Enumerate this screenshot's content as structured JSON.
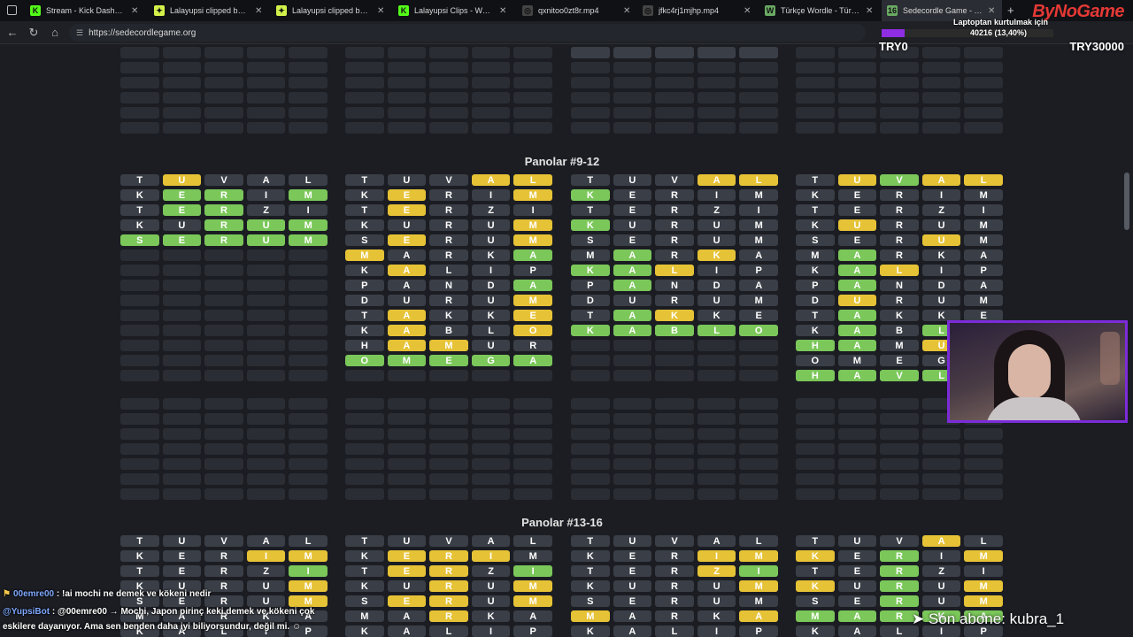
{
  "tabs": [
    {
      "label": "Stream - Kick Dashboard",
      "icon": "kick-icon",
      "icon_text": "K",
      "icon_color": "#53fc18"
    },
    {
      "label": "Lalayupsi clipped by cinoc",
      "icon": "clip-icon",
      "icon_text": "✦",
      "icon_color": "#d2f14a"
    },
    {
      "label": "Lalayupsi clipped by FFYou",
      "icon": "clip-icon",
      "icon_text": "✦",
      "icon_color": "#d2f14a"
    },
    {
      "label": "Lalayupsi Clips - Watch Liv",
      "icon": "kick-icon",
      "icon_text": "K",
      "icon_color": "#53fc18"
    },
    {
      "label": "qxnitoo0zt8r.mp4",
      "icon": "globe-icon",
      "icon_text": "◎",
      "icon_color": "#444"
    },
    {
      "label": "jfkc4rj1mjhp.mp4",
      "icon": "globe-icon",
      "icon_text": "◎",
      "icon_color": "#444"
    },
    {
      "label": "Türkçe Wordle - Türkçe Kel",
      "icon": "wordle-icon",
      "icon_text": "W",
      "icon_color": "#6aaa64"
    },
    {
      "label": "Sedecordle Game - 16 Wo",
      "icon": "sedecordle-icon",
      "icon_text": "16",
      "icon_color": "#6aaa64"
    }
  ],
  "url": "https://sedecordlegame.org",
  "overlay": {
    "brand": "ByNoGame",
    "laptop_label": "Laptoptan kurtulmak için",
    "progress_text": "40216 (13,40%)",
    "progress_fraction": 0.134,
    "try_left": "TRY0",
    "try_right": "TRY30000",
    "sub_ticker": "➤ Son abone: kubra_1"
  },
  "sections": [
    {
      "title": "Panolar #9-12"
    },
    {
      "title": "Panolar #13-16"
    }
  ],
  "boards_9_12": [
    {
      "rows": [
        "T.U-V.A.L",
        "K.E+R+I.M+",
        "T.E+R+Z.I",
        "K.U.R+U+M+",
        "S+E+R+U+M+"
      ]
    },
    {
      "rows": [
        "T.U.V.A-L-",
        "K.E-R.I.M-",
        "T.E-R.Z.I",
        "K.U.R.U.M-",
        "S.E-R.U.M-",
        "M-A.R.K.A+",
        "K.A-L.I.P",
        "P.A.N.D.A+",
        "D.U.R.U.M-",
        "T.A-K.K.E-",
        "K.A-B.L.O-",
        "H.A-M-U.R",
        "O+M+E+G+A+"
      ]
    },
    {
      "rows": [
        "T.U.V.A-L-",
        "K+E.R.I.M",
        "T.E.R.Z.I",
        "K+U.R.U.M",
        "S.E.R.U.M",
        "M.A+R.K-A",
        "K+A+L-I.P",
        "P.A+N.D.A",
        "D.U.R.U.M",
        "T.A+K-K.E",
        "K+A+B+L+O+"
      ]
    },
    {
      "rows": [
        "T.U-V+A-L-",
        "K.E.R.I.M",
        "T.E.R.Z.I",
        "K.U-R.U.M",
        "S.E.R.U-M",
        "M.A+R.K.A",
        "K.A+L-I.P",
        "P.A+N.D.A",
        "D.U-R.U.M",
        "T.A+K.K.E",
        "K.A+B.L+O",
        "H+A+M.U-L",
        "O.M.E.G.A",
        "H+A+V+L+Y"
      ]
    }
  ],
  "boards_13_16": [
    {
      "rows": [
        "T.U.V.A.L",
        "K.E.R.I-M-",
        "T.E.R.Z.I+",
        "K.U.R.U.M-",
        "S.E.R.U.M-",
        "M.A.R.K.A",
        "K.A.L.I.P"
      ]
    },
    {
      "rows": [
        "T.U.V.A.L",
        "K.E-R-I-M",
        "T.E-R-Z.I+",
        "K.U.R-U.M-",
        "S.E-R-U.M-",
        "M.A.R-K.A",
        "K.A.L.I.P"
      ]
    },
    {
      "rows": [
        "T.U.V.A.L",
        "K.E.R.I-M-",
        "T.E.R.Z-I+",
        "K.U.R.U.M-",
        "S.E.R.U.M",
        "M-A.R.K.A-",
        "K.A.L.I.P"
      ]
    },
    {
      "rows": [
        "T.U.V.A-L",
        "K-E.R+I.M-",
        "T.E.R+Z.I",
        "K-U.R+U.M-",
        "S.E.R+U.M-",
        "M+A+R+K+A+",
        "K.A.L.I.P"
      ]
    }
  ],
  "chat": [
    {
      "badge": "⚑",
      "name": "00emre00",
      "text": ": !ai mochi ne demek ve kökeni nedir"
    },
    {
      "badge": "",
      "name": "@YupsiBot",
      "text": ": @00emre00 → Mochi, Japon pirinç keki demek ve kökeni çok"
    },
    {
      "badge": "",
      "name": "",
      "text": "eskilere dayanıyor. Ama sen benden daha iyi biliyorsundur, değil mi. ☺"
    }
  ],
  "colors": {
    "green": "#7bc75a",
    "yellow": "#e6c236",
    "gray": "#3a3e46",
    "empty": "#2a2d34",
    "accent": "#7c2bd9",
    "brand": "#e53935"
  }
}
